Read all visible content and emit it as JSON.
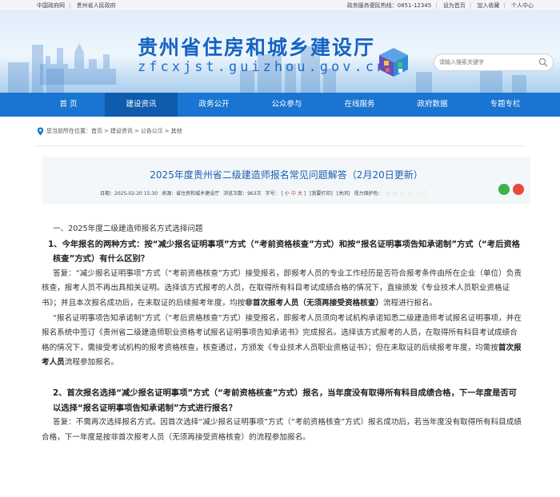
{
  "topbar": {
    "left_links": [
      "中国政府网",
      "贵州省人民政府"
    ],
    "right_items": [
      "政务服务便民热线：0851-12345",
      "设为首页",
      "加入收藏",
      "个人中心"
    ]
  },
  "header": {
    "title": "贵州省住房和城乡建设厅",
    "domain": "zfcxjst.guizhou.gov.cn",
    "search_placeholder": "请输入搜索关键字"
  },
  "nav": {
    "items": [
      {
        "label": "首 页"
      },
      {
        "label": "建设资讯"
      },
      {
        "label": "政务公开"
      },
      {
        "label": "公众参与"
      },
      {
        "label": "在线服务"
      },
      {
        "label": "政府数据"
      },
      {
        "label": "专题专栏"
      }
    ],
    "active_index": 1
  },
  "breadcrumb": {
    "prefix": "您当前所在位置：",
    "items": [
      "首页",
      "建设资讯",
      "公告公示",
      "其他"
    ]
  },
  "article": {
    "title": "2025年度贵州省二级建造师报名常见问题解答（2月20日更新）",
    "meta": {
      "date": "日期：2025-02-20 15:30",
      "source": "来源：省住房和城乡建设厅",
      "views": "浏览次数：963次",
      "size_label": "字号：",
      "size_small": "[ 小",
      "size_mid": "中",
      "size_big": "大 ]",
      "favorite": "[我要打印]",
      "close": "[关闭]",
      "eye_label": "视力保护色："
    },
    "eye_colors": [
      "#f6e6ea",
      "#e3eef8",
      "#e8f3e3",
      "#eeeeee",
      "#fbf3dd",
      "#ffffff"
    ],
    "share_colors": [
      "#3fb14a",
      "#e84a3c"
    ]
  },
  "content": {
    "section1": "一、2025年度二级建造师报名方式选择问题",
    "q1_heading": "1、今年报名的两种方式：按“减少报名证明事项”方式（“考前资格核查”方式）和按“报名证明事项告知承诺制”方式（“考后资格核查”方式）有什么区别？",
    "a1_p1_part1": "答复：“减少报名证明事项”方式（“考前资格核查”方式）接受报名，即报考人员的专业工作经历是否符合报考条件由所在企业（单位）负责核查，报考人员不再出具相关证明。选择该方式报考的人员，在取得所有科目考试成绩合格的情况下，直接颁发《专业技术人员职业资格证书》；并且本次报名成功后，在未取证的后续报考年度，均按",
    "a1_p1_bold": "非首次报考人员（无须再接受资格核查）",
    "a1_p1_part2": "流程进行报名。",
    "a1_p2_part1": "“报名证明事项告知承诺制”方式（“考后资格核查”方式）接受报名，即报考人员须向考试机构承诺知悉二级建造师考试报名证明事项，并在报名系统中签订《贵州省二级建造师职业资格考试报名证明事项告知承诺书》完成报名。选择该方式报考的人员，在取得所有科目考试成绩合格的情况下，需接受考试机构的报考资格核查，核查通过，方颁发《专业技术人员职业资格证书》；但在未取证的后续报考年度，均需按",
    "a1_p2_bold": "首次报考人员",
    "a1_p2_part2": "流程参加报名。",
    "q2_heading": "2、首次报名选择“减少报名证明事项”方式（“考前资格核查”方式）报名，当年度没有取得所有科目成绩合格，下一年度是否可以选择“报名证明事项告知承诺制”方式进行报名？",
    "a2": "答复：不需再次选择报名方式。因首次选择“减少报名证明事项”方式（“考前资格核查”方式）报名成功后，若当年度没有取得所有科目成绩合格，下一年度是按非首次报考人员（无须再接受资格核查）的流程参加报名。"
  }
}
